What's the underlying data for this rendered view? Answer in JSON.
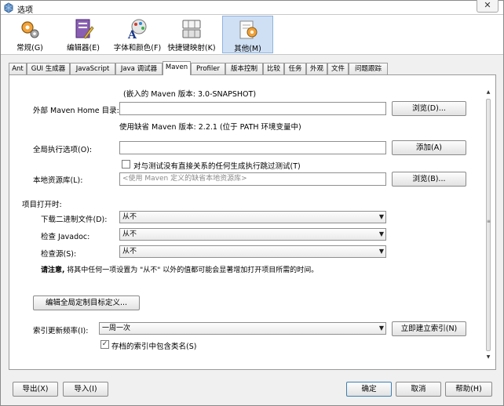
{
  "window": {
    "title": "选项",
    "close_glyph": "✕"
  },
  "categories": [
    {
      "label": "常规(G)",
      "icon": "gear-icon"
    },
    {
      "label": "编辑器(E)",
      "icon": "editor-icon"
    },
    {
      "label": "字体和颜色(F)",
      "icon": "font-color-icon"
    },
    {
      "label": "快捷键映射(K)",
      "icon": "keyboard-icon"
    },
    {
      "label": "其他(M)",
      "icon": "misc-icon",
      "selected": true
    }
  ],
  "tabs": [
    "Ant",
    "GUI 生成器",
    "JavaScript",
    "Java 调试器",
    "Maven",
    "Profiler",
    "版本控制",
    "比较",
    "任务",
    "外观",
    "文件",
    "问题跟踪"
  ],
  "active_tab": "Maven",
  "maven": {
    "bundled_note": "(嵌入的 Maven 版本: 3.0-SNAPSHOT)",
    "home_label": "外部 Maven Home 目录:",
    "home_value": "",
    "browse_d": "浏览(D)...",
    "default_note": "使用缺省 Maven 版本: 2.2.1 (位于 PATH 环境变量中)",
    "global_label": "全局执行选项(O):",
    "global_value": "",
    "add_button": "添加(A)",
    "skip_tests_label": "对与测试没有直接关系的任何生成执行跳过测试(T)",
    "skip_tests_checked": false,
    "repo_label": "本地资源库(L):",
    "repo_placeholder": "<使用 Maven 定义的缺省本地资源库>",
    "browse_b": "浏览(B)...",
    "on_open_label": "项目打开时:",
    "binaries_label": "下载二进制文件(D):",
    "binaries_value": "从不",
    "javadoc_label": "检查 Javadoc:",
    "javadoc_value": "从不",
    "source_label": "检查源(S):",
    "source_value": "从不",
    "note_bold": "请注意,",
    "note_text": "将其中任何一项设置为 \"从不\" 以外的值都可能会显著增加打开项目所需的时间。",
    "edit_goals_button": "编辑全局定制目标定义...",
    "index_label": "索引更新频率(I):",
    "index_value": "一周一次",
    "index_now_button": "立即建立索引(N)",
    "archive_label": "存档的索引中包含类名(S)",
    "archive_checked": true
  },
  "footer": {
    "export": "导出(X)",
    "import": "导入(I)",
    "ok": "确定",
    "cancel": "取消",
    "help": "帮助(H)"
  },
  "scroll_glyphs": {
    "up": "▲",
    "down": "▼",
    "grip": "≡"
  },
  "combo_glyph": "▼",
  "check_glyph": "✓"
}
